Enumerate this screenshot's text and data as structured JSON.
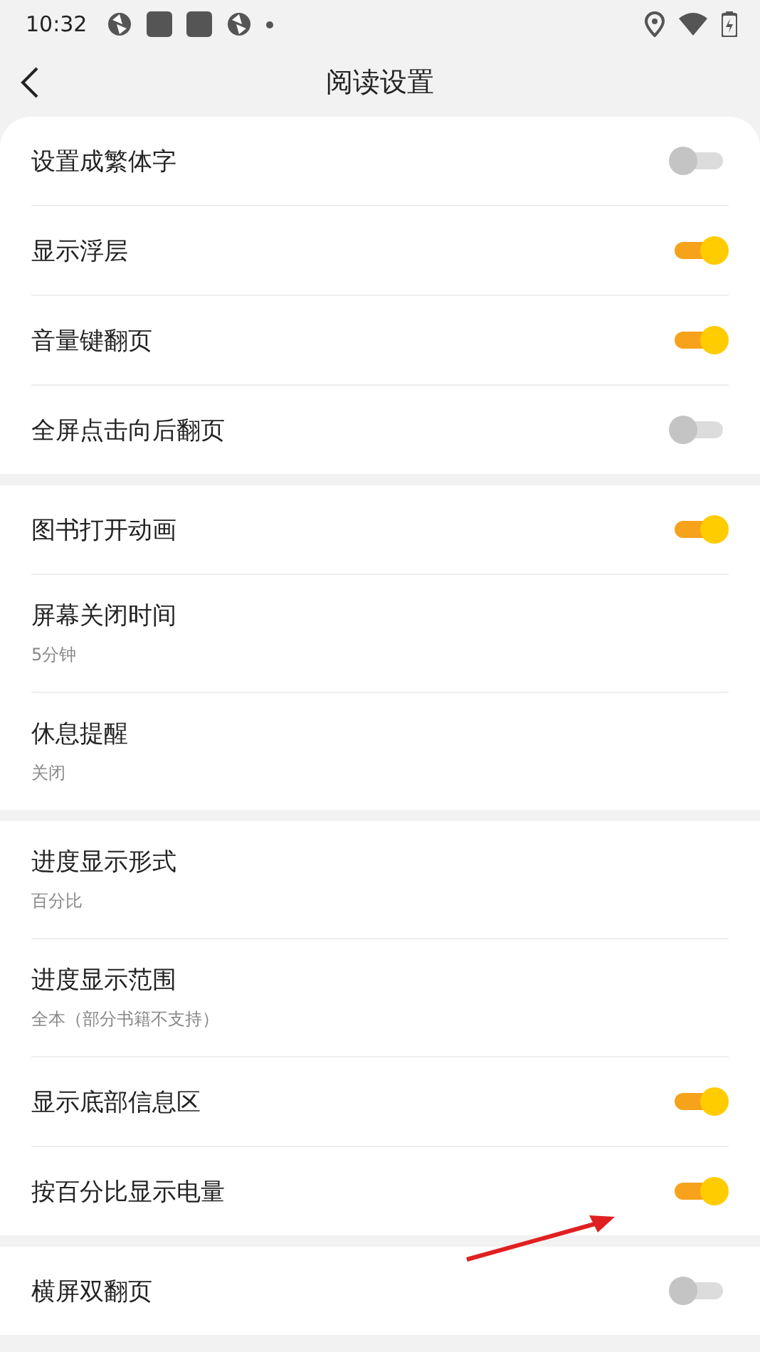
{
  "status_bar": {
    "time": "10:32"
  },
  "header": {
    "title": "阅读设置"
  },
  "sections": [
    {
      "items": [
        {
          "kind": "toggle",
          "label": "设置成繁体字",
          "on": false
        },
        {
          "kind": "toggle",
          "label": "显示浮层",
          "on": true
        },
        {
          "kind": "toggle",
          "label": "音量键翻页",
          "on": true
        },
        {
          "kind": "toggle",
          "label": "全屏点击向后翻页",
          "on": false
        }
      ]
    },
    {
      "items": [
        {
          "kind": "toggle",
          "label": "图书打开动画",
          "on": true
        },
        {
          "kind": "value",
          "label": "屏幕关闭时间",
          "value": "5分钟"
        },
        {
          "kind": "value",
          "label": "休息提醒",
          "value": "关闭"
        }
      ]
    },
    {
      "items": [
        {
          "kind": "value",
          "label": "进度显示形式",
          "value": "百分比"
        },
        {
          "kind": "value",
          "label": "进度显示范围",
          "value": "全本（部分书籍不支持）"
        },
        {
          "kind": "toggle",
          "label": "显示底部信息区",
          "on": true
        },
        {
          "kind": "toggle",
          "label": "按百分比显示电量",
          "on": true
        }
      ]
    },
    {
      "items": [
        {
          "kind": "toggle",
          "label": "横屏双翻页",
          "on": false
        }
      ]
    }
  ]
}
